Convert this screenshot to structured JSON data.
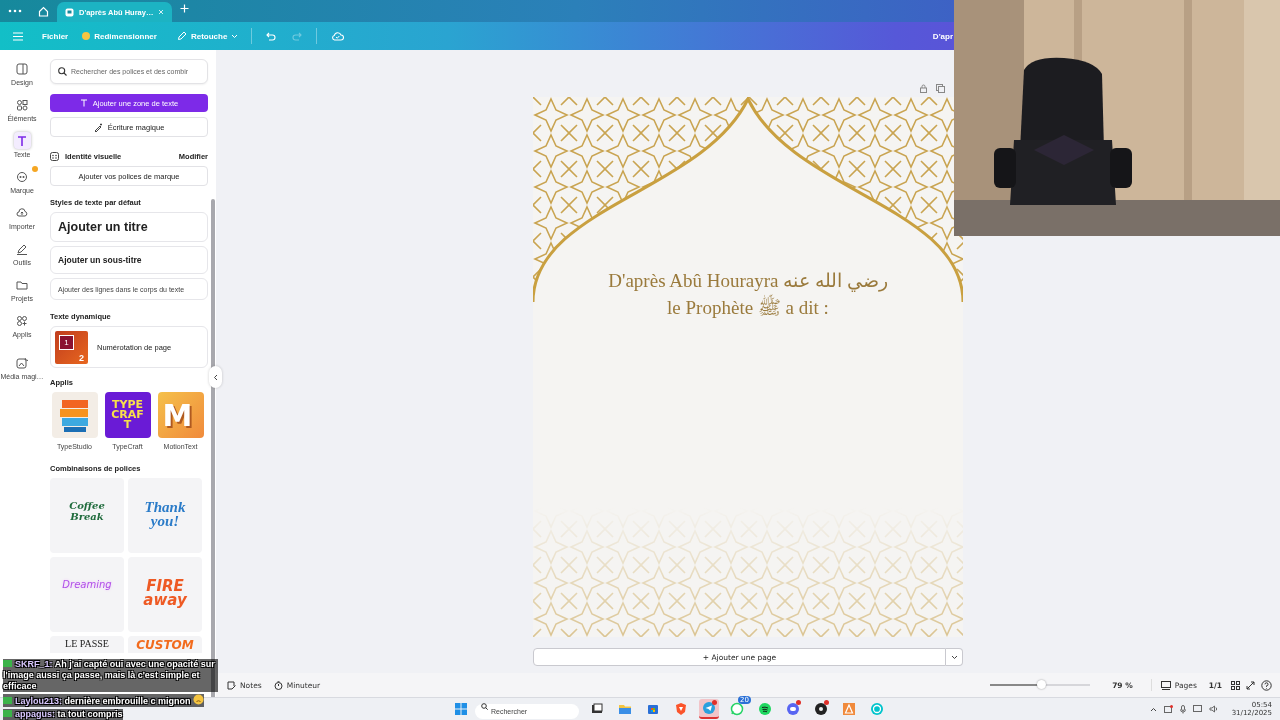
{
  "browser": {
    "tabs": [
      {
        "label": "D'après Abû Huray…",
        "selected": true
      }
    ]
  },
  "toolbar": {
    "menu": "Fichier",
    "resize": "Redimensionner",
    "edit": "Retouche",
    "undo": {
      "disabled": false
    },
    "redo": {
      "disabled": true
    },
    "doc_title": "D'apr"
  },
  "rail": [
    {
      "label": "Design",
      "selected": false,
      "badge": false
    },
    {
      "label": "Éléments",
      "selected": false,
      "badge": false
    },
    {
      "label": "Texte",
      "selected": true,
      "badge": false
    },
    {
      "label": "Marque",
      "selected": false,
      "badge": true
    },
    {
      "label": "Importer",
      "selected": false,
      "badge": false
    },
    {
      "label": "Outils",
      "selected": false,
      "badge": false
    },
    {
      "label": "Projets",
      "selected": false,
      "badge": false
    },
    {
      "label": "Applis",
      "selected": false,
      "badge": false
    },
    {
      "label": "Média magi…",
      "selected": false,
      "badge": false
    }
  ],
  "panel": {
    "search": {
      "placeholder": "Rechercher des polices et des combir"
    },
    "add_text_button": "Ajouter une zone de texte",
    "magic_write_button": "Écriture magique",
    "brand": {
      "title": "Identité visuelle",
      "edit_link": "Modifier",
      "button": "Ajouter vos polices de marque"
    },
    "default_styles": {
      "title": "Styles de texte par défaut",
      "items": [
        {
          "kind": "title",
          "label": "Ajouter un titre"
        },
        {
          "kind": "subtitle",
          "label": "Ajouter un sous-titre"
        },
        {
          "kind": "body",
          "label": "Ajouter des lignes dans le corps du texte"
        }
      ]
    },
    "dynamic_text": {
      "title": "Texte dynamique",
      "item": "Numérotation de page",
      "thumb_numbers": [
        "1",
        "2"
      ]
    },
    "apps": {
      "title": "Applis",
      "items": [
        {
          "kind": "typestudio",
          "label": "TypeStudio"
        },
        {
          "kind": "typecraft",
          "label": "TypeCraft",
          "art": "TYPE CRAFT"
        },
        {
          "kind": "motiontext",
          "label": "MotionText",
          "art": "M"
        }
      ]
    },
    "font_combos": {
      "title": "Combinaisons de polices",
      "items": [
        {
          "kind": "coffee",
          "text": "Coffee Break"
        },
        {
          "kind": "thanks",
          "text": "Thank you!"
        },
        {
          "kind": "glow",
          "text": "Dreaming"
        },
        {
          "kind": "fire",
          "text": "FIRE away"
        },
        {
          "kind": "passe",
          "text": "LE PASSE"
        },
        {
          "kind": "paint",
          "text": "CUSTOM"
        }
      ]
    }
  },
  "canvas": {
    "lines": [
      "D'après Abû Hourayra رضي الله عنه",
      "le Prophète ﷺ a dit :"
    ],
    "add_page": "+ Ajouter une page"
  },
  "bottom_bar": {
    "notes": "Notes",
    "timer": "Minuteur",
    "zoom": {
      "level": 0.52
    },
    "zoom_reading": "79 %",
    "pages": "Pages",
    "page_count": "1/1"
  },
  "taskbar": {
    "search": {
      "placeholder": "Rechercher"
    },
    "apps": [
      {
        "selected": false,
        "alert": false
      },
      {
        "selected": false,
        "alert": false
      },
      {
        "selected": false,
        "alert": false
      },
      {
        "selected": false,
        "alert": false
      },
      {
        "selected": true,
        "alert": true
      },
      {
        "selected": false,
        "alert": false,
        "badge": "20"
      },
      {
        "selected": false,
        "alert": false
      },
      {
        "selected": false,
        "alert": true
      },
      {
        "selected": false,
        "alert": true
      },
      {
        "selected": false,
        "alert": false
      },
      {
        "selected": false,
        "alert": false
      }
    ],
    "time": "05:54",
    "date": "31/12/2025"
  },
  "chat": [
    {
      "user": "SKRF_1:",
      "text": "Ah j'ai capté oui avec une opacité sur l'image aussi ça passe, mais là c'est simple et efficace",
      "emoji": false
    },
    {
      "user": "Laylou213:",
      "text": "dernière embrouille c mignon",
      "emoji": true
    },
    {
      "user": "appagus:",
      "text": "ta tout compris",
      "emoji": false
    }
  ]
}
